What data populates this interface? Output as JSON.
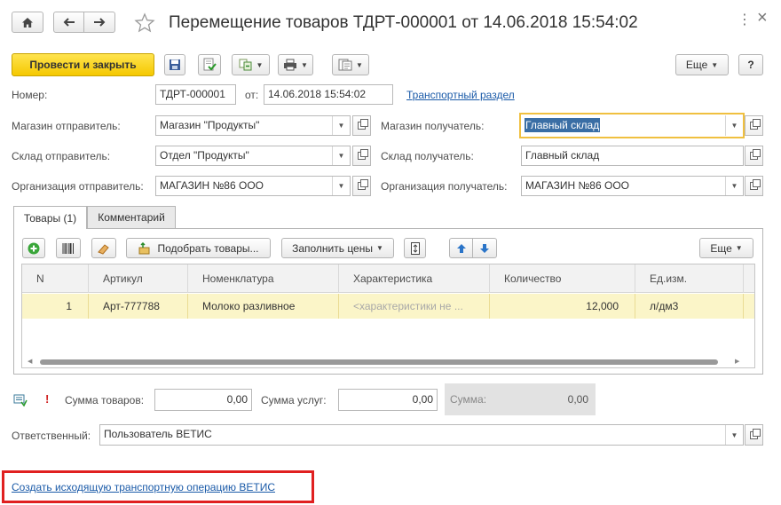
{
  "window": {
    "title": "Перемещение товаров ТДРТ-000001 от 14.06.2018 15:54:02",
    "close_glyph": "×",
    "more_glyph": "⋮"
  },
  "toolbar": {
    "post_close_label": "Провести и закрыть",
    "more_label": "Еще",
    "help_label": "?"
  },
  "header": {
    "number_label": "Номер:",
    "number_value": "ТДРТ-000001",
    "date_label": "от:",
    "date_value": "14.06.2018 15:54:02",
    "transport_link": "Транспортный раздел",
    "store_sender_label": "Магазин отправитель:",
    "store_sender_value": "Магазин \"Продукты\"",
    "store_receiver_label": "Магазин получатель:",
    "store_receiver_value": "Главный склад",
    "warehouse_sender_label": "Склад отправитель:",
    "warehouse_sender_value": "Отдел \"Продукты\"",
    "warehouse_receiver_label": "Склад получатель:",
    "warehouse_receiver_value": "Главный склад",
    "org_sender_label": "Организация отправитель:",
    "org_sender_value": "МАГАЗИН №86 ООО",
    "org_receiver_label": "Организация получатель:",
    "org_receiver_value": "МАГАЗИН №86 ООО"
  },
  "tabs": [
    {
      "label": "Товары (1)",
      "active": true
    },
    {
      "label": "Комментарий",
      "active": false
    }
  ],
  "table_toolbar": {
    "pick_goods_label": "Подобрать товары...",
    "fill_prices_label": "Заполнить цены",
    "more_label": "Еще"
  },
  "table": {
    "columns": [
      "N",
      "Артикул",
      "Номенклатура",
      "Характеристика",
      "Количество",
      "Ед.изм."
    ],
    "rows": [
      {
        "n": "1",
        "article": "Арт-777788",
        "item": "Молоко разливное",
        "characteristic": "<характеристики не ...",
        "quantity": "12,000",
        "unit": "л/дм3"
      }
    ]
  },
  "totals": {
    "warning_mark": "!",
    "goods_label": "Сумма товаров:",
    "goods_value": "0,00",
    "services_label": "Сумма услуг:",
    "services_value": "0,00",
    "total_label": "Сумма:",
    "total_value": "0,00"
  },
  "responsible": {
    "label": "Ответственный:",
    "value": "Пользователь ВЕТИС"
  },
  "footer": {
    "create_link": "Создать исходящую транспортную операцию ВЕТИС",
    "highlight_color": "#e02020"
  },
  "colors": {
    "primary_button": "#f5c800",
    "link": "#1a5aa8",
    "selected_row": "#fbf5c8",
    "focus_border": "#f0c040",
    "selection": "#3a6ea5"
  }
}
